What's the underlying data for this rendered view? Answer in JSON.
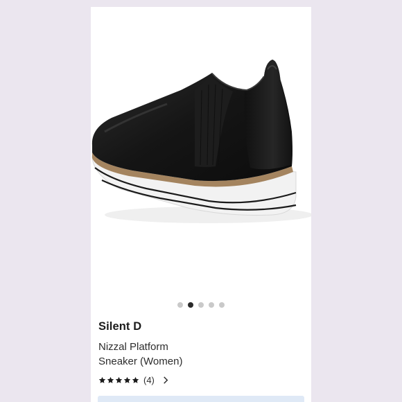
{
  "product": {
    "brand": "Silent D",
    "name_line1": "Nizzal Platform",
    "name_line2": "Sneaker (Women)",
    "rating": {
      "stars": 5,
      "review_count": "(4)"
    }
  },
  "gallery": {
    "image_count": 5,
    "active_index": 1
  },
  "icons": {
    "star": "star-icon",
    "chevron": "chevron-right-icon"
  },
  "colors": {
    "page_background": "#ebe6ef",
    "card_background": "#ffffff",
    "text_primary": "#1b1b1b",
    "dot_active": "#2a2a2a",
    "dot_inactive": "#c9c9c9",
    "accent_bar": "#dfe9f6"
  }
}
